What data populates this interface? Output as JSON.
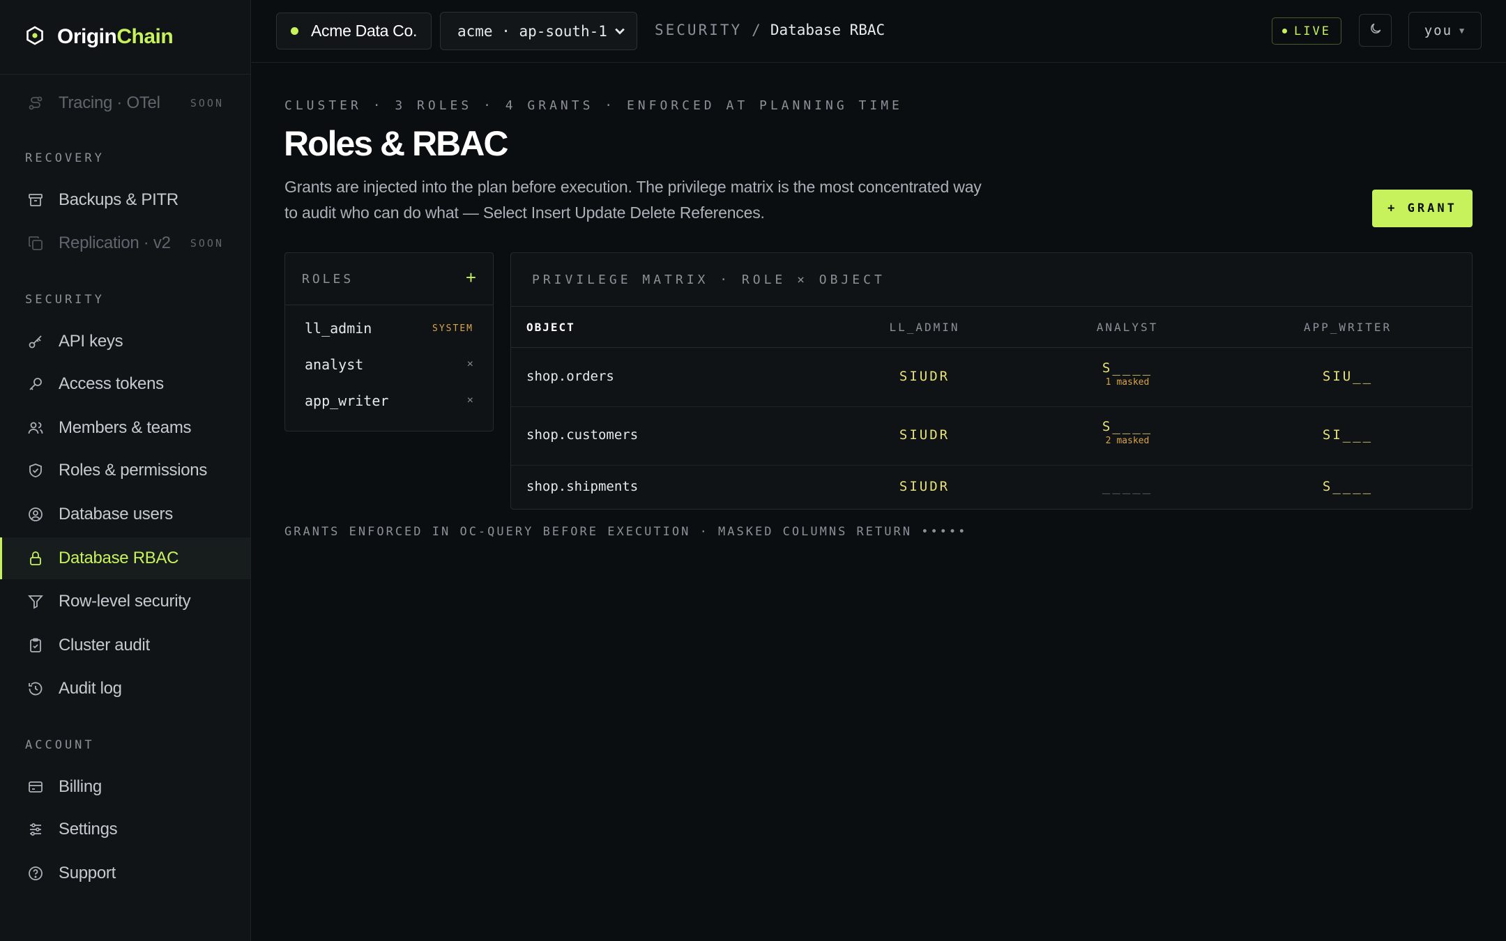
{
  "brand": {
    "name_part1": "Origin",
    "name_part2": "Chain"
  },
  "sidebar": {
    "top_item": {
      "label": "Tracing · OTel",
      "badge": "SOON"
    },
    "sections": {
      "recovery": "RECOVERY",
      "security": "SECURITY",
      "account": "ACCOUNT"
    },
    "recovery_items": [
      {
        "label": "Backups & PITR",
        "icon": "archive-icon"
      },
      {
        "label": "Replication · v2",
        "icon": "copy-icon",
        "badge": "SOON"
      }
    ],
    "security_items": [
      {
        "label": "API keys",
        "icon": "key-icon"
      },
      {
        "label": "Access tokens",
        "icon": "token-key-icon"
      },
      {
        "label": "Members & teams",
        "icon": "users-icon"
      },
      {
        "label": "Roles & permissions",
        "icon": "shield-check-icon"
      },
      {
        "label": "Database users",
        "icon": "user-circle-icon"
      },
      {
        "label": "Database RBAC",
        "icon": "lock-icon",
        "active": true
      },
      {
        "label": "Row-level security",
        "icon": "filter-icon"
      },
      {
        "label": "Cluster audit",
        "icon": "clipboard-check-icon"
      },
      {
        "label": "Audit log",
        "icon": "history-icon"
      }
    ],
    "account_items": [
      {
        "label": "Billing",
        "icon": "credit-card-icon"
      },
      {
        "label": "Settings",
        "icon": "sliders-icon"
      },
      {
        "label": "Support",
        "icon": "help-circle-icon"
      }
    ]
  },
  "topbar": {
    "org": "Acme Data Co.",
    "cluster": "acme · ap-south-1",
    "breadcrumb": {
      "section": "SECURITY",
      "separator": "/",
      "current": "Database RBAC"
    },
    "live": "LIVE",
    "user": "you"
  },
  "page": {
    "eyebrow": "CLUSTER · 3 ROLES · 4 GRANTS · ENFORCED AT PLANNING TIME",
    "title": "Roles & RBAC",
    "description": "Grants are injected into the plan before execution. The privilege matrix is the most concentrated way to audit who can do what — Select Insert Update Delete References.",
    "grant_button": "+ GRANT",
    "footnote": "GRANTS ENFORCED IN OC-QUERY BEFORE EXECUTION · MASKED COLUMNS RETURN •••••"
  },
  "roles_panel": {
    "title": "ROLES",
    "add": "+",
    "roles": [
      {
        "name": "ll_admin",
        "tag": "SYSTEM"
      },
      {
        "name": "analyst",
        "remove": "×"
      },
      {
        "name": "app_writer",
        "remove": "×"
      }
    ]
  },
  "matrix": {
    "title": "PRIVILEGE MATRIX · ROLE × OBJECT",
    "columns": [
      "OBJECT",
      "LL_ADMIN",
      "ANALYST",
      "APP_WRITER"
    ],
    "rows": [
      {
        "object": "shop.orders",
        "ll_admin": "SIUDR",
        "analyst": "S____",
        "analyst_note": "1 masked",
        "app_writer": "SIU__"
      },
      {
        "object": "shop.customers",
        "ll_admin": "SIUDR",
        "analyst": "S____",
        "analyst_note": "2 masked",
        "app_writer": "SI___"
      },
      {
        "object": "shop.shipments",
        "ll_admin": "SIUDR",
        "analyst": "_____",
        "app_writer": "S____"
      }
    ]
  },
  "colors": {
    "accent": "#c8f25c",
    "privilege": "#e8e27a",
    "warning": "#d9a44a",
    "background": "#0b0e10"
  }
}
